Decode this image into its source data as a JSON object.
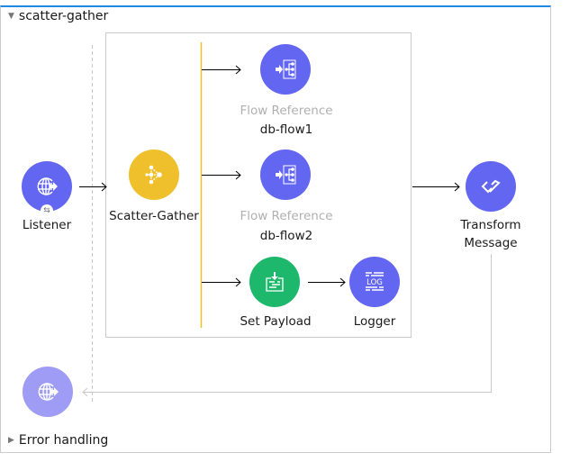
{
  "flow": {
    "name": "scatter-gather",
    "expanded": true,
    "accent_color": "#1e88e5"
  },
  "error_handling": {
    "label": "Error handling",
    "expanded": false
  },
  "colors": {
    "connector": "#6366f1",
    "connector_return": "#9f9cf6",
    "router": "#f0c02c",
    "transformer": "#1db86b",
    "router_bar": "#f0c02c"
  },
  "nodes": {
    "listener": {
      "label": "Listener",
      "icon": "globe-arrow-icon",
      "badge_icon": "exchange-icon"
    },
    "scatter_gather": {
      "label": "Scatter-Gather",
      "icon": "scatter-icon"
    },
    "flow_ref_1": {
      "type_label": "Flow Reference",
      "label": "db-flow1",
      "icon": "flow-reference-icon"
    },
    "flow_ref_2": {
      "type_label": "Flow Reference",
      "label": "db-flow2",
      "icon": "flow-reference-icon"
    },
    "set_payload": {
      "label": "Set Payload",
      "icon": "set-payload-icon"
    },
    "logger": {
      "label": "Logger",
      "icon": "log-icon",
      "icon_text": "LOG"
    },
    "transform": {
      "label_line1": "Transform",
      "label_line2": "Message",
      "icon": "dataweave-icon"
    },
    "listener_response": {
      "icon": "globe-arrow-icon"
    }
  }
}
